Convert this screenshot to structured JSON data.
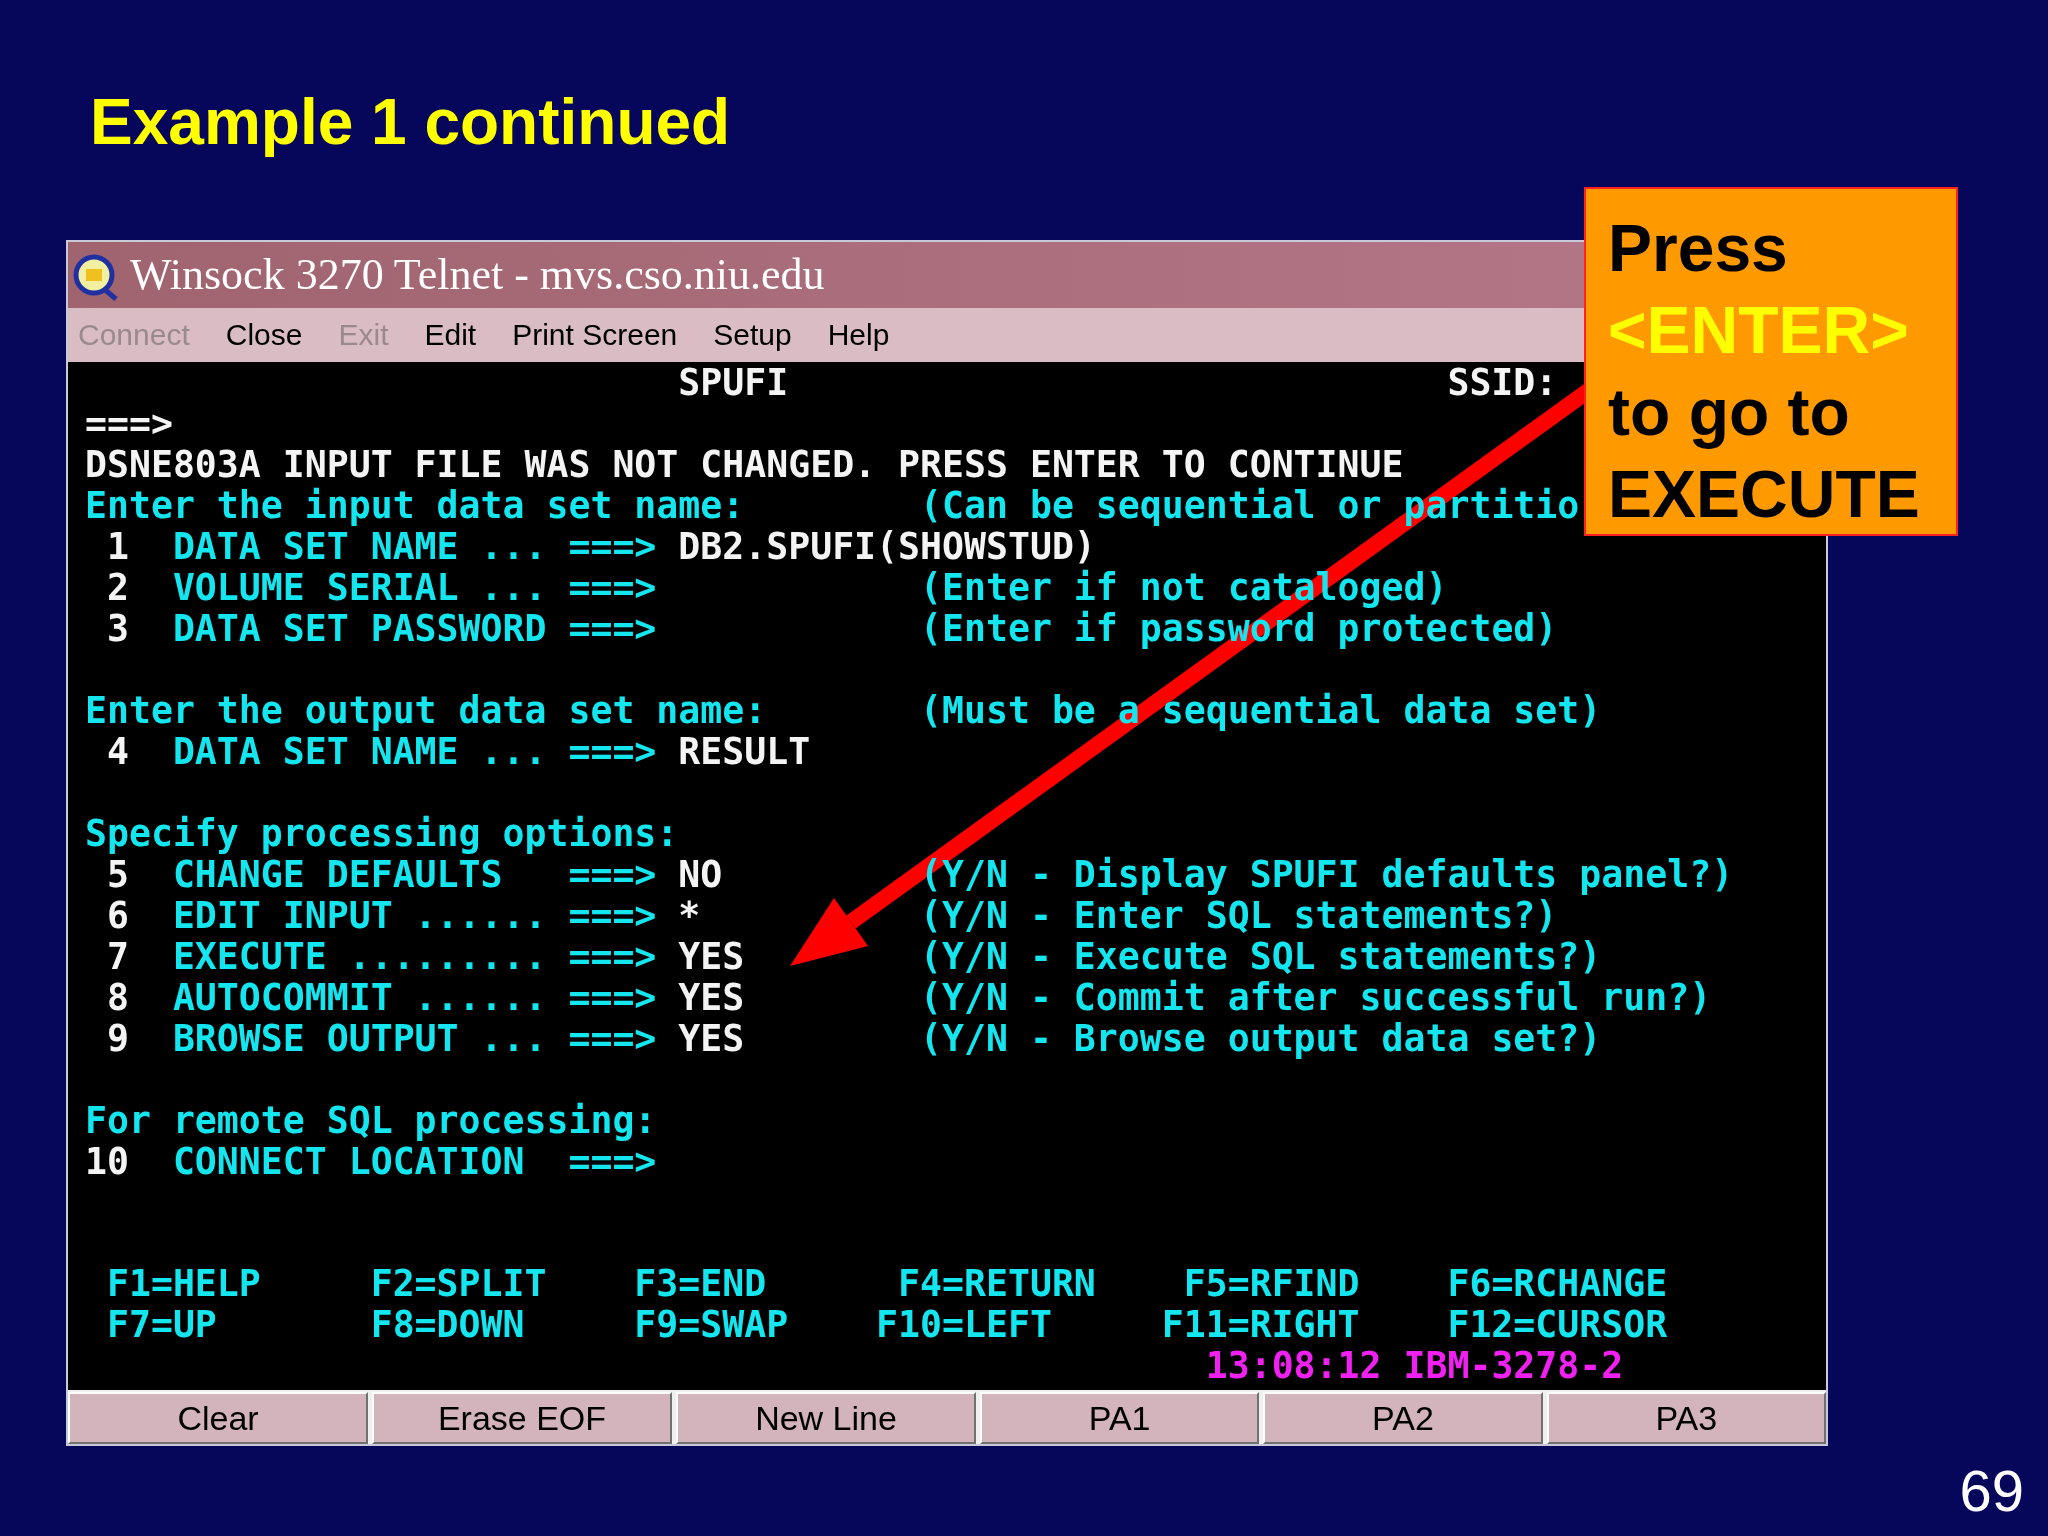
{
  "slide": {
    "title": "Example 1 continued",
    "page_number": "69"
  },
  "window": {
    "title": "Winsock 3270 Telnet - mvs.cso.niu.edu",
    "menu": [
      {
        "label": "Connect",
        "disabled": true
      },
      {
        "label": "Close",
        "disabled": false
      },
      {
        "label": "Exit",
        "disabled": true
      },
      {
        "label": "Edit",
        "disabled": false
      },
      {
        "label": "Print Screen",
        "disabled": false
      },
      {
        "label": "Setup",
        "disabled": false
      },
      {
        "label": "Help",
        "disabled": false
      }
    ],
    "terminal": [
      {
        "lines": [
          {
            "segments": [
              {
                "text": "                           SPUFI",
                "kind": "output"
              },
              {
                "text": "                              SSID:",
                "kind": "output"
              }
            ]
          },
          {
            "segments": [
              {
                "text": "===>",
                "kind": "output"
              }
            ]
          },
          {
            "segments": [
              {
                "text": "DSNE803A INPUT FILE WAS NOT CHANGED. PRESS ENTER TO CONTINUE",
                "kind": "output"
              }
            ]
          },
          {
            "segments": [
              {
                "text": "Enter the input data set name:",
                "kind": "label"
              },
              {
                "text": "        (Can be sequential or partitio",
                "kind": "label"
              }
            ]
          },
          {
            "segments": [
              {
                "text": " 1",
                "kind": "output"
              },
              {
                "text": "  DATA SET NAME ... ===>",
                "kind": "label"
              },
              {
                "text": " DB2.SPUFI(SHOWSTUD)",
                "kind": "output"
              }
            ]
          },
          {
            "segments": [
              {
                "text": " 2",
                "kind": "output"
              },
              {
                "text": "  VOLUME SERIAL ... ===>",
                "kind": "label"
              },
              {
                "text": "            (Enter if not cataloged)",
                "kind": "label"
              }
            ]
          },
          {
            "segments": [
              {
                "text": " 3",
                "kind": "output"
              },
              {
                "text": "  DATA SET PASSWORD ===>",
                "kind": "label"
              },
              {
                "text": "            (Enter if password protected)",
                "kind": "label"
              }
            ]
          }
        ]
      },
      {
        "lines": [
          {
            "segments": [
              {
                "text": "Enter the output data set name:",
                "kind": "label"
              },
              {
                "text": "       (Must be a sequential data set)",
                "kind": "label"
              }
            ]
          },
          {
            "segments": [
              {
                "text": " 4",
                "kind": "output"
              },
              {
                "text": "  DATA SET NAME ... ===>",
                "kind": "label"
              },
              {
                "text": " RESULT",
                "kind": "output"
              }
            ]
          }
        ]
      },
      {
        "lines": [
          {
            "segments": [
              {
                "text": "Specify processing options:",
                "kind": "label"
              }
            ]
          },
          {
            "segments": [
              {
                "text": " 5",
                "kind": "output"
              },
              {
                "text": "  CHANGE DEFAULTS   ===>",
                "kind": "label"
              },
              {
                "text": " NO",
                "kind": "output"
              },
              {
                "text": "         (Y/N - Display SPUFI defaults panel?)",
                "kind": "label"
              }
            ]
          },
          {
            "segments": [
              {
                "text": " 6",
                "kind": "output"
              },
              {
                "text": "  EDIT INPUT ...... ===>",
                "kind": "label"
              },
              {
                "text": " *",
                "kind": "output"
              },
              {
                "text": "          (Y/N - Enter SQL statements?)",
                "kind": "label"
              }
            ]
          },
          {
            "segments": [
              {
                "text": " 7",
                "kind": "output"
              },
              {
                "text": "  EXECUTE ......... ===>",
                "kind": "label"
              },
              {
                "text": " YES",
                "kind": "output"
              },
              {
                "text": "        (Y/N - Execute SQL statements?)",
                "kind": "label"
              }
            ]
          },
          {
            "segments": [
              {
                "text": " 8",
                "kind": "output"
              },
              {
                "text": "  AUTOCOMMIT ...... ===>",
                "kind": "label"
              },
              {
                "text": " YES",
                "kind": "output"
              },
              {
                "text": "        (Y/N - Commit after successful run?)",
                "kind": "label"
              }
            ]
          },
          {
            "segments": [
              {
                "text": " 9",
                "kind": "output"
              },
              {
                "text": "  BROWSE OUTPUT ... ===>",
                "kind": "label"
              },
              {
                "text": " YES",
                "kind": "output"
              },
              {
                "text": "        (Y/N - Browse output data set?)",
                "kind": "label"
              }
            ]
          }
        ]
      },
      {
        "lines": [
          {
            "segments": [
              {
                "text": "For remote SQL processing:",
                "kind": "label"
              }
            ]
          },
          {
            "segments": [
              {
                "text": "10",
                "kind": "output"
              },
              {
                "text": "  CONNECT LOCATION  ===>",
                "kind": "label"
              }
            ]
          }
        ]
      },
      {
        "lines": [
          {
            "segments": [
              {
                "text": " F1=HELP",
                "kind": "label"
              },
              {
                "text": "     F2=SPLIT",
                "kind": "label"
              },
              {
                "text": "    F3=END",
                "kind": "label"
              },
              {
                "text": "      F4=RETURN",
                "kind": "label"
              },
              {
                "text": "    F5=RFIND",
                "kind": "label"
              },
              {
                "text": "    F6=RCHANGE",
                "kind": "label"
              }
            ]
          },
          {
            "segments": [
              {
                "text": " F7=UP",
                "kind": "label"
              },
              {
                "text": "       F8=DOWN",
                "kind": "label"
              },
              {
                "text": "     F9=SWAP",
                "kind": "label"
              },
              {
                "text": "    F10=LEFT",
                "kind": "label"
              },
              {
                "text": "     F11=RIGHT",
                "kind": "label"
              },
              {
                "text": "    F12=CURSOR",
                "kind": "label"
              }
            ]
          },
          {
            "segments": [
              {
                "text": "                                                   13:08:12 IBM-3278-2",
                "kind": "status"
              }
            ]
          }
        ]
      }
    ],
    "keys": [
      "Clear",
      "Erase EOF",
      "New Line",
      "PA1",
      "PA2",
      "PA3"
    ]
  },
  "callout": {
    "lines": [
      {
        "text": "Press",
        "highlight": false
      },
      {
        "text": "<ENTER>",
        "highlight": true
      },
      {
        "text": "to go to",
        "highlight": false
      },
      {
        "text": "EXECUTE",
        "highlight": false
      }
    ]
  }
}
